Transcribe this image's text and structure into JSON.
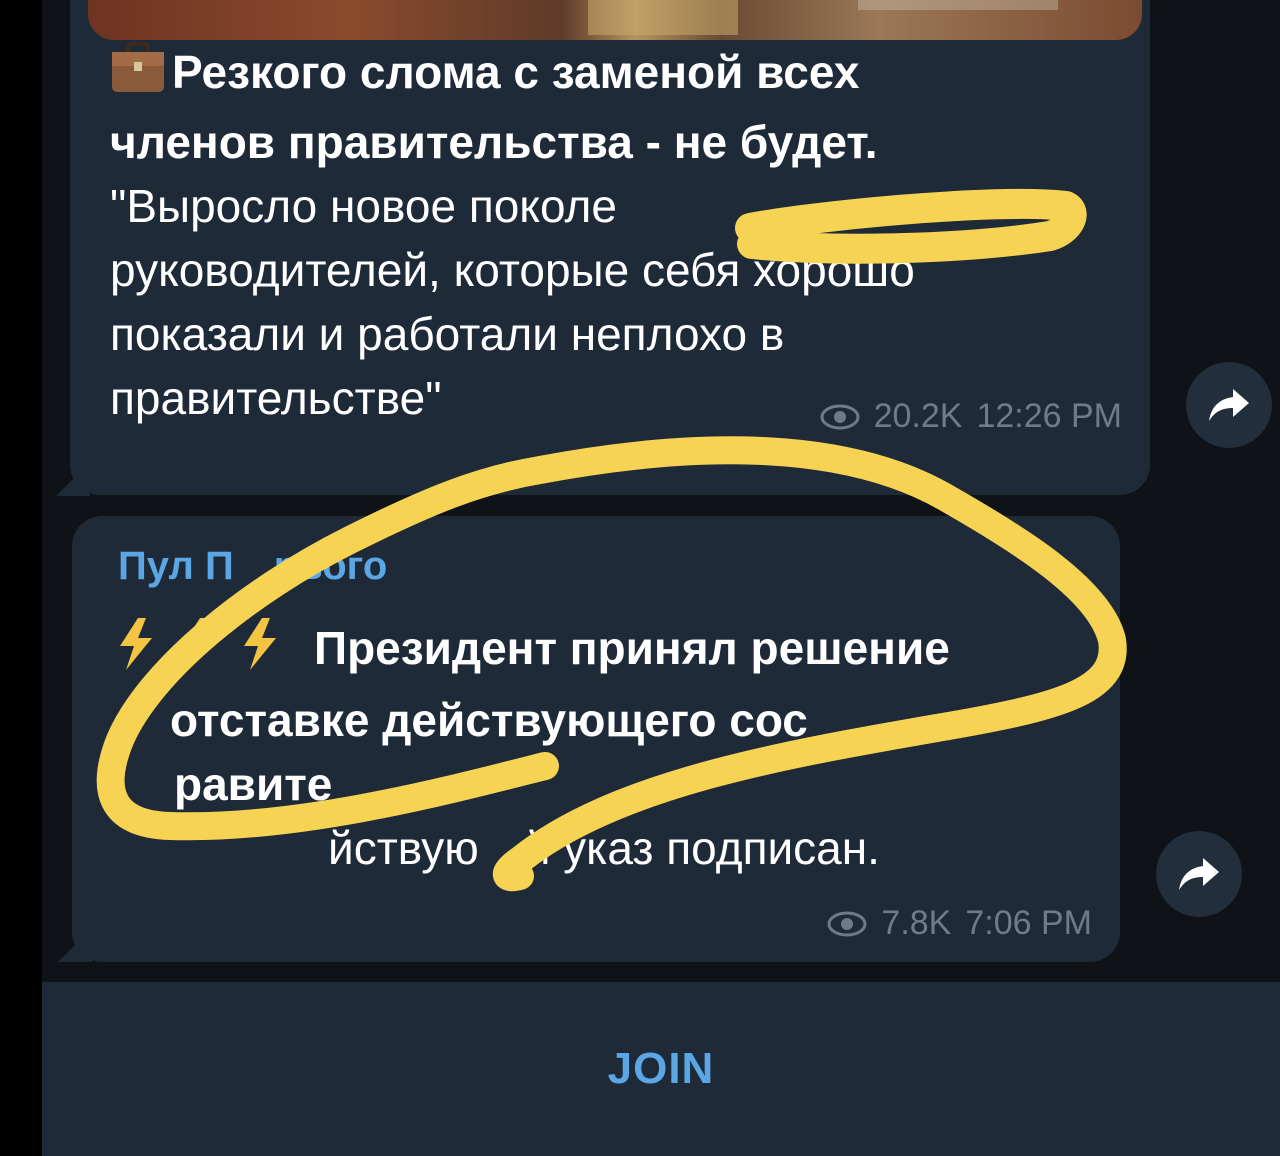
{
  "posts": [
    {
      "emoji": "briefcase-emoji",
      "lines": [
        "Резкого слома с заменой всех",
        "членов правительства - не будет.",
        "\"Выросло новое поколе",
        "руководителей, которые себя хорошо",
        "показали и работали неплохо в",
        "правительстве\""
      ],
      "views": "20.2K",
      "time": "12:26 PM"
    },
    {
      "sender": "Пул П",
      "sender_tail": "рвого",
      "emoji": "lightning-emoji",
      "lines": [
        "Президент принял решение",
        "отставке действующего сос",
        "равите",
        "йствую",
        "й указ подписан."
      ],
      "views": "7.8K",
      "time": "7:06 PM"
    }
  ],
  "footer": {
    "join_label": "JOIN"
  },
  "colors": {
    "background": "#0f1217",
    "bubble": "#1e2a38",
    "accent": "#5ba7e6",
    "meta": "#6d7b8a",
    "highlighter": "#f7d354"
  },
  "icons": [
    "share-icon",
    "eye-icon",
    "briefcase-emoji",
    "lightning-emoji"
  ]
}
